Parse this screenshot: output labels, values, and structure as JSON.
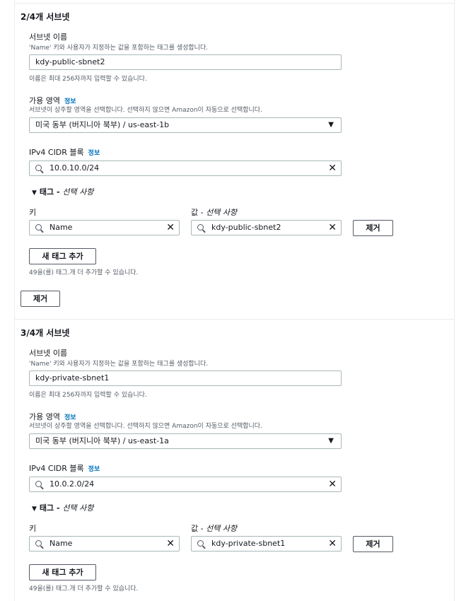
{
  "subnets": [
    {
      "title": "2/4개 서브넷",
      "name_label": "서브넷 이름",
      "name_desc": "'Name' 키와 사용자가 지정하는 값을 포함하는 태그를 생성합니다.",
      "name_value": "kdy-public-sbnet2",
      "name_hint": "이름은 최대 256자까지 입력할 수 있습니다.",
      "az_label": "가용 영역",
      "az_info": "정보",
      "az_desc": "서브넷이 상주할 영역을 선택합니다. 선택하지 않으면 Amazon이 자동으로 선택합니다.",
      "az_value": "미국 동부 (버지니아 북부) / us-east-1b",
      "cidr_label": "IPv4 CIDR 블록",
      "cidr_info": "정보",
      "cidr_value": "10.0.10.0/24",
      "tags_toggle": "태그 - ",
      "tags_toggle_opt": "선택 사항",
      "key_label": "키",
      "value_label": "값 - ",
      "value_label_opt": "선택 사항",
      "tag_key": "Name",
      "tag_value": "kdy-public-sbnet2",
      "remove_tag_label": "제거",
      "add_tag_label": "새 태그 추가",
      "tags_remaining": "49을(를) 태그.개 더 추가할 수 있습니다.",
      "remove_subnet_label": "제거"
    },
    {
      "title": "3/4개 서브넷",
      "name_label": "서브넷 이름",
      "name_desc": "'Name' 키와 사용자가 지정하는 값을 포함하는 태그를 생성합니다.",
      "name_value": "kdy-private-sbnet1",
      "name_hint": "이름은 최대 256자까지 입력할 수 있습니다.",
      "az_label": "가용 영역",
      "az_info": "정보",
      "az_desc": "서브넷이 상주할 영역을 선택합니다. 선택하지 않으면 Amazon이 자동으로 선택합니다.",
      "az_value": "미국 동부 (버지니아 북부) / us-east-1a",
      "cidr_label": "IPv4 CIDR 블록",
      "cidr_info": "정보",
      "cidr_value": "10.0.2.0/24",
      "tags_toggle": "태그 - ",
      "tags_toggle_opt": "선택 사항",
      "key_label": "키",
      "value_label": "값 - ",
      "value_label_opt": "선택 사항",
      "tag_key": "Name",
      "tag_value": "kdy-private-sbnet1",
      "remove_tag_label": "제거",
      "add_tag_label": "새 태그 추가",
      "tags_remaining": "49을(를) 태그.개 더 추가할 수 있습니다."
    }
  ]
}
